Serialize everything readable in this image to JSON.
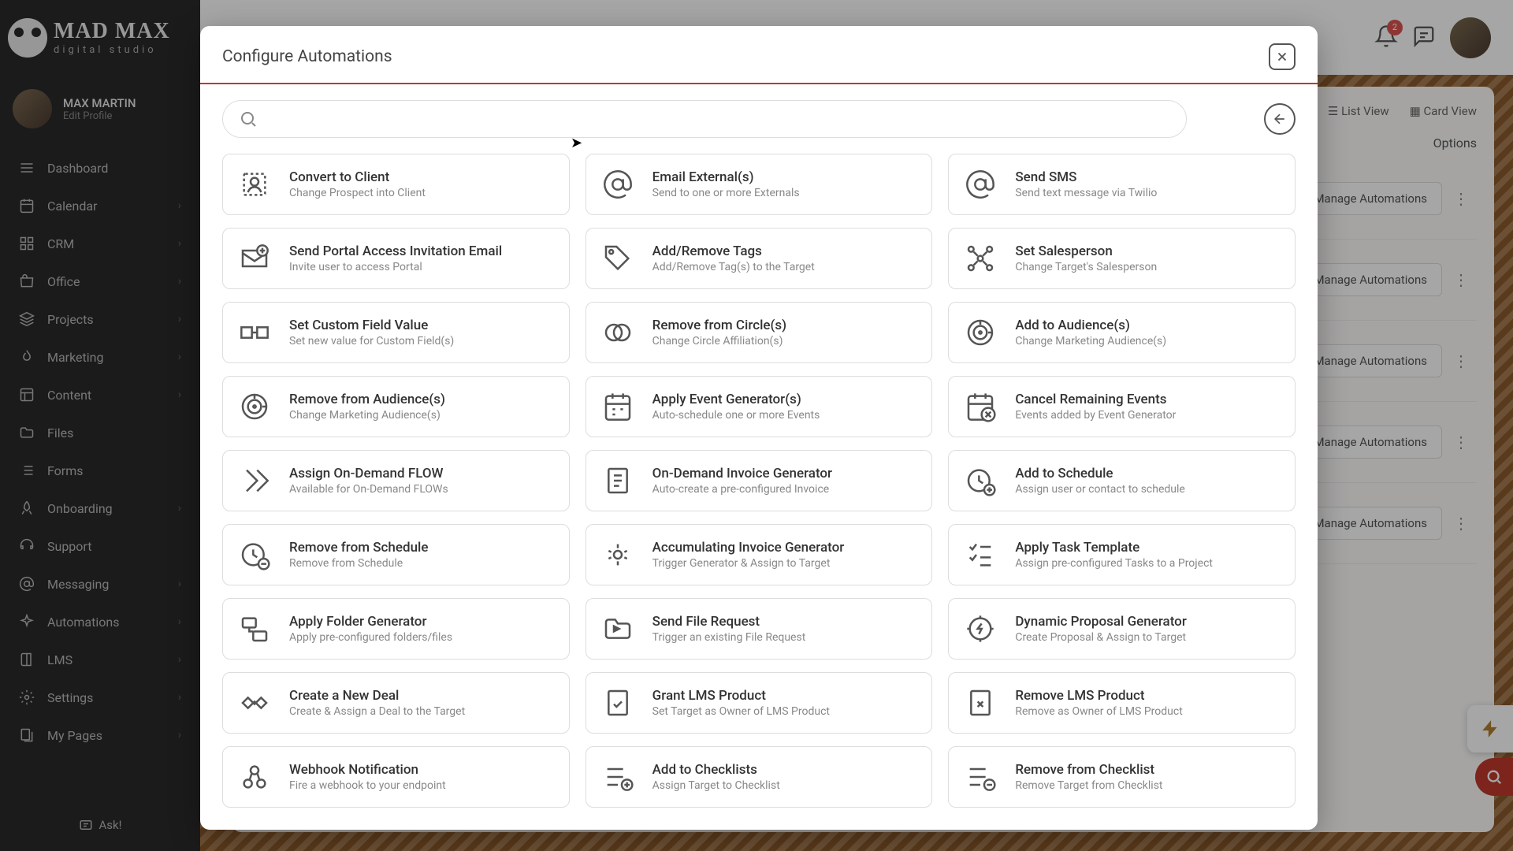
{
  "brand": {
    "name": "MAD MAX",
    "tagline": "digital studio"
  },
  "user": {
    "name": "MAX MARTIN",
    "edit": "Edit Profile"
  },
  "nav": [
    {
      "label": "Dashboard",
      "icon": "menu",
      "expandable": false
    },
    {
      "label": "Calendar",
      "icon": "calendar",
      "expandable": true
    },
    {
      "label": "CRM",
      "icon": "grid",
      "expandable": true
    },
    {
      "label": "Office",
      "icon": "bag",
      "expandable": true
    },
    {
      "label": "Projects",
      "icon": "layers",
      "expandable": true
    },
    {
      "label": "Marketing",
      "icon": "flame",
      "expandable": true
    },
    {
      "label": "Content",
      "icon": "layout",
      "expandable": true
    },
    {
      "label": "Files",
      "icon": "folder",
      "expandable": false
    },
    {
      "label": "Forms",
      "icon": "list",
      "expandable": false
    },
    {
      "label": "Onboarding",
      "icon": "rocket",
      "expandable": true
    },
    {
      "label": "Support",
      "icon": "headset",
      "expandable": false
    },
    {
      "label": "Messaging",
      "icon": "at",
      "expandable": true
    },
    {
      "label": "Automations",
      "icon": "sparkle",
      "expandable": true
    },
    {
      "label": "LMS",
      "icon": "book",
      "expandable": true
    },
    {
      "label": "Settings",
      "icon": "gear",
      "expandable": true
    },
    {
      "label": "My Pages",
      "icon": "pages",
      "expandable": true
    }
  ],
  "ask": "Ask!",
  "topbar": {
    "notif_count": "2"
  },
  "bg": {
    "list_view": "List View",
    "card_view": "Card View",
    "options": "Options",
    "manage": "Manage Automations"
  },
  "modal": {
    "title": "Configure Automations",
    "search_placeholder": ""
  },
  "cards": [
    {
      "title": "Convert to Client",
      "desc": "Change Prospect into Client",
      "icon": "user-convert"
    },
    {
      "title": "Email External(s)",
      "desc": "Send to one or more Externals",
      "icon": "at"
    },
    {
      "title": "Send SMS",
      "desc": "Send text message via Twilio",
      "icon": "at"
    },
    {
      "title": "Send Portal Access Invitation Email",
      "desc": "Invite user to access Portal",
      "icon": "mail-plus"
    },
    {
      "title": "Add/Remove Tags",
      "desc": "Add/Remove Tag(s) to the Target",
      "icon": "tag"
    },
    {
      "title": "Set Salesperson",
      "desc": "Change Target's Salesperson",
      "icon": "nodes"
    },
    {
      "title": "Set Custom Field Value",
      "desc": "Set new value for Custom Field(s)",
      "icon": "field"
    },
    {
      "title": "Remove from Circle(s)",
      "desc": "Change Circle Affiliation(s)",
      "icon": "circles"
    },
    {
      "title": "Add to Audience(s)",
      "desc": "Change Marketing Audience(s)",
      "icon": "target"
    },
    {
      "title": "Remove from Audience(s)",
      "desc": "Change Marketing Audience(s)",
      "icon": "target"
    },
    {
      "title": "Apply Event Generator(s)",
      "desc": "Auto-schedule one or more Events",
      "icon": "calendar"
    },
    {
      "title": "Cancel Remaining Events",
      "desc": "Events added by Event Generator",
      "icon": "calendar-x"
    },
    {
      "title": "Assign On-Demand FLOW",
      "desc": "Available for On-Demand FLOWs",
      "icon": "chevrons"
    },
    {
      "title": "On-Demand Invoice Generator",
      "desc": "Auto-create a pre-configured Invoice",
      "icon": "invoice"
    },
    {
      "title": "Add to Schedule",
      "desc": "Assign user or contact to schedule",
      "icon": "clock-plus"
    },
    {
      "title": "Remove from Schedule",
      "desc": "Remove from Schedule",
      "icon": "clock-minus"
    },
    {
      "title": "Accumulating Invoice Generator",
      "desc": "Trigger Generator & Assign to Target",
      "icon": "gear-doc"
    },
    {
      "title": "Apply Task Template",
      "desc": "Assign pre-configured Tasks to a Project",
      "icon": "checklist"
    },
    {
      "title": "Apply Folder Generator",
      "desc": "Apply pre-configured folders/files",
      "icon": "folder-tree"
    },
    {
      "title": "Send File Request",
      "desc": "Trigger an existing File Request",
      "icon": "folder-send"
    },
    {
      "title": "Dynamic Proposal Generator",
      "desc": "Create Proposal & Assign to Target",
      "icon": "gear-bolt"
    },
    {
      "title": "Create a New Deal",
      "desc": "Create & Assign a Deal to the Target",
      "icon": "handshake"
    },
    {
      "title": "Grant LMS Product",
      "desc": "Set Target as Owner of LMS Product",
      "icon": "doc-check"
    },
    {
      "title": "Remove LMS Product",
      "desc": "Remove as Owner of LMS Product",
      "icon": "doc-x"
    },
    {
      "title": "Webhook Notification",
      "desc": "Fire a webhook to your endpoint",
      "icon": "webhook"
    },
    {
      "title": "Add to Checklists",
      "desc": "Assign Target to Checklist",
      "icon": "list-plus"
    },
    {
      "title": "Remove from Checklist",
      "desc": "Remove Target from Checklist",
      "icon": "list-minus"
    }
  ]
}
